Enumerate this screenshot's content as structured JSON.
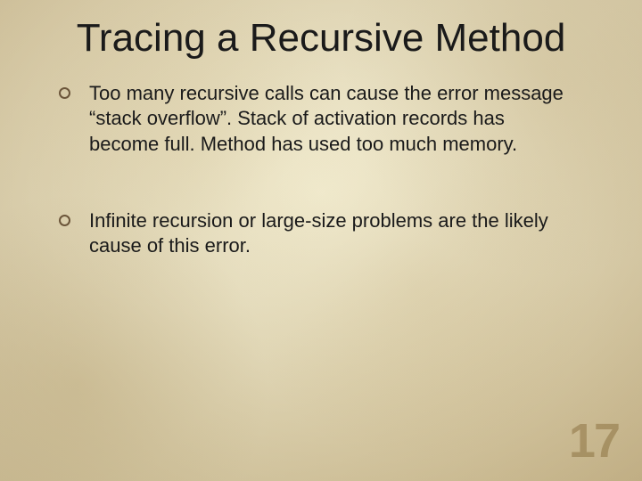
{
  "title": "Tracing a Recursive Method",
  "bullets": [
    "Too many recursive calls can cause the error message “stack overflow”. Stack of activation records has become full. Method has used too much memory.",
    "Infinite recursion or large-size problems are the likely cause of this error."
  ],
  "page_number": "17"
}
